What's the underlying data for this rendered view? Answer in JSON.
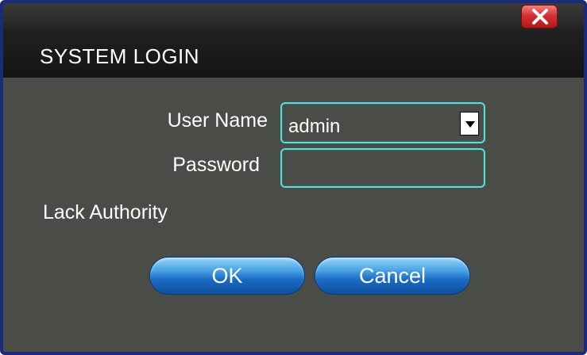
{
  "dialog": {
    "title": "SYSTEM LOGIN",
    "close_icon": "close-x-icon",
    "accent_color": "#5fd8d8",
    "close_color": "#d83030",
    "button_color": "#1a6cc4"
  },
  "form": {
    "username_label": "User Name",
    "username_value": "admin",
    "dropdown_icon": "chevron-down-icon",
    "password_label": "Password",
    "password_value": "",
    "status_message": "Lack Authority"
  },
  "buttons": {
    "ok_label": "OK",
    "cancel_label": "Cancel"
  }
}
